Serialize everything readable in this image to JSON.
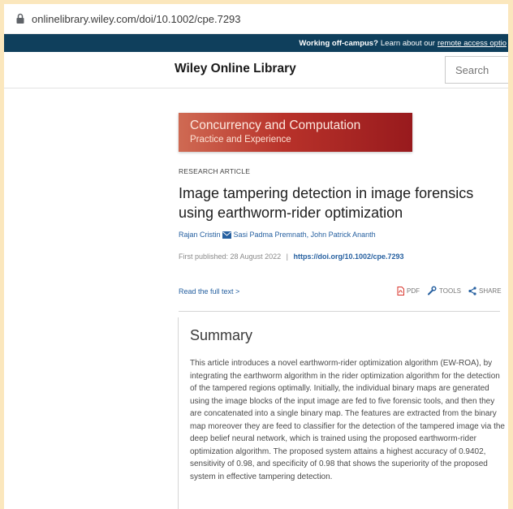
{
  "browser": {
    "url": "onlinelibrary.wiley.com/doi/10.1002/cpe.7293"
  },
  "banner": {
    "bold": "Working off-campus?",
    "text": "Learn about our",
    "link": "remote access optio"
  },
  "header": {
    "brand": "Wiley Online Library",
    "search_placeholder": "Search"
  },
  "journal": {
    "title": "Concurrency and Computation",
    "subtitle": "Practice and Experience"
  },
  "article": {
    "type": "RESEARCH ARTICLE",
    "title": "Image tampering detection in image forensics using earthworm-rider optimization",
    "authors": {
      "first": "Rajan Cristin",
      "rest": "Sasi Padma Premnath, John Patrick Ananth"
    },
    "published_label": "First published:",
    "published_date": "28 August 2022",
    "separator": "|",
    "doi": "https://doi.org/10.1002/cpe.7293"
  },
  "actions": {
    "full_text": "Read the full text >",
    "pdf": "PDF",
    "tools": "TOOLS",
    "share": "SHARE"
  },
  "summary": {
    "heading": "Summary",
    "text": "This article introduces a novel earthworm-rider optimization algorithm (EW-ROA), by integrating the earthworm algorithm in the rider optimization algorithm for the detection of the tampered regions optimally. Initially, the individual binary maps are generated using the image blocks of the input image are fed to five forensic tools, and then they are concatenated into a single binary map. The features are extracted from the binary map moreover they are feed to classifier for the detection of the tampered image via the deep belief neural network, which is trained using the proposed earthworm-rider optimization algorithm. The proposed system attains a highest accuracy of 0.9402, sensitivity of 0.98, and specificity of 0.98 that shows the superiority of the proposed system in effective tampering detection."
  }
}
